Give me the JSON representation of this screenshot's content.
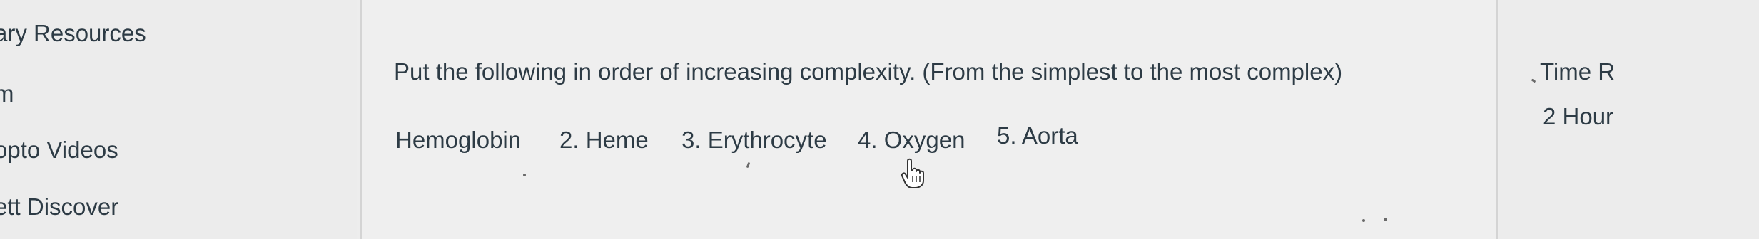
{
  "sidebar": {
    "items": [
      {
        "label": "ary Resources"
      },
      {
        "label": "m"
      },
      {
        "label": "opto Videos"
      },
      {
        "label": "ett Discover"
      }
    ]
  },
  "question": {
    "prompt": "Put the following in order of increasing complexity. (From the simplest to the most complex)",
    "items": [
      {
        "label": "Hemoglobin"
      },
      {
        "label": "2. Heme"
      },
      {
        "label": "3. Erythrocyte"
      },
      {
        "label": "4. Oxygen"
      },
      {
        "label": "5. Aorta"
      }
    ]
  },
  "timer": {
    "label": "Time R",
    "value": "2 Hour"
  },
  "icons": {
    "cursor": "hand-pointer-icon"
  }
}
